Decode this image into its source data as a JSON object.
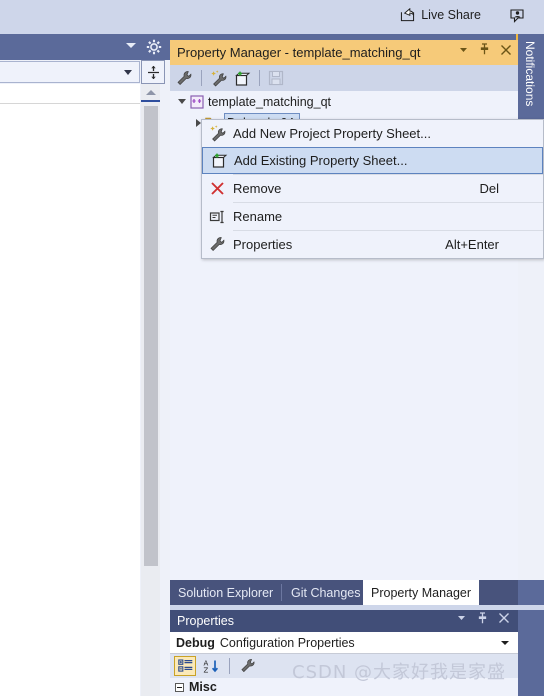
{
  "topbar": {
    "live_share_label": "Live Share",
    "live_share_icon": "share-arrow-icon",
    "feedback_icon": "send-feedback-icon"
  },
  "notifications": {
    "label": "Notifications"
  },
  "left_panel": {
    "combo_value": "",
    "gear_icon": "gear-icon",
    "split_icon": "split-view-icon"
  },
  "property_manager": {
    "title": "Property Manager - template_matching_qt",
    "controls": {
      "dropdown": "▾",
      "pin": "✕",
      "close": "✕"
    },
    "toolbar": [
      {
        "name": "properties-wrench-icon"
      },
      {
        "name": "add-new-project-property-sheet-icon"
      },
      {
        "name": "add-existing-property-sheet-icon"
      },
      {
        "name": "save-icon"
      }
    ],
    "tree": {
      "root_label": "template_matching_qt",
      "child_label": "Debug | x64"
    }
  },
  "context_menu": {
    "items": [
      {
        "label": "Add New Project Property Sheet...",
        "accel": "",
        "icon": "new-property-sheet-icon",
        "highlighted": false
      },
      {
        "label": "Add Existing Property Sheet...",
        "accel": "",
        "icon": "add-existing-sheet-icon",
        "highlighted": true
      },
      {
        "label": "Remove",
        "accel": "Del",
        "icon": "remove-x-icon",
        "highlighted": false
      },
      {
        "label": "Rename",
        "accel": "",
        "icon": "rename-icon",
        "highlighted": false
      },
      {
        "label": "Properties",
        "accel": "Alt+Enter",
        "icon": "wrench-icon",
        "highlighted": false
      }
    ]
  },
  "bottom_tabs": [
    {
      "label": "Solution Explorer",
      "active": false
    },
    {
      "label": "Git Changes",
      "active": false
    },
    {
      "label": "Property Manager",
      "active": true
    }
  ],
  "properties_panel": {
    "title": "Properties",
    "controls": {
      "dropdown": "▾",
      "pin": "✕",
      "close": "✕"
    },
    "selector_bold": "Debug",
    "selector_rest": "Configuration Properties",
    "toolbar": [
      {
        "name": "categorized-view-icon",
        "selected": true
      },
      {
        "name": "alphabetical-sort-icon",
        "selected": false
      },
      {
        "name": "property-pages-wrench-icon",
        "selected": false
      }
    ],
    "first_group": "Misc"
  },
  "watermark": "CSDN @大家好我是家盛",
  "colors": {
    "chrome_blue": "#5b6a9a",
    "title_orange": "#f6ca79",
    "menu_highlight": "#cddcf2",
    "panel_bg": "#eff2fb"
  }
}
